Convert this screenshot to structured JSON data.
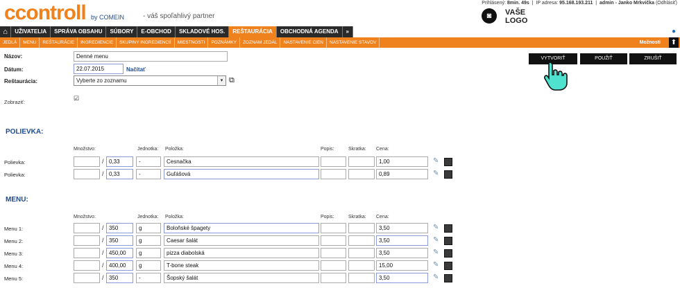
{
  "header": {
    "logo": "ccontroll",
    "by": "by COMEIN",
    "tagline": "- váš spoľahlivý partner",
    "session": {
      "logged_label": "Prihlásený:",
      "logged_time": "8min. 49s",
      "ip_label": "IP adresa:",
      "ip": "95.168.193.211",
      "user": "admin - Janko Mrkvička",
      "logout": "(Odhlásiť)"
    },
    "your_logo_line1": "VAŠE",
    "your_logo_line2": "LOGO"
  },
  "main_nav": [
    {
      "label": "UŽIVATELIA"
    },
    {
      "label": "SPRÁVA OBSAHU"
    },
    {
      "label": "SÚBORY"
    },
    {
      "label": "E-OBCHOD"
    },
    {
      "label": "SKLADOVÉ HOS."
    },
    {
      "label": "REŠTAURÁCIA",
      "active": true
    },
    {
      "label": "OBCHODNÁ AGENDA"
    },
    {
      "label": "»"
    }
  ],
  "sub_nav": [
    "JEDLÁ",
    "MENU",
    "REŠTAURÁCIE",
    "INGREDIENCIE",
    "SKUPINY INGREDIENCIÍ",
    "MIESTNOSTI",
    "POZNÁMKY",
    "ZOZNAM JEDÁL",
    "NASTAVENIE CIEN",
    "NASTAVENIE STAVOV"
  ],
  "options_label": "Možnosti",
  "form": {
    "name_label": "Názov:",
    "name_value": "Denné menu",
    "date_label": "Dátum:",
    "date_value": "22.07.2015",
    "load_link": "Načítať",
    "restaurant_label": "Reštaurácia:",
    "restaurant_value": "Vyberte zo zoznamu",
    "show_label": "Zobraziť:",
    "show_checked": true
  },
  "buttons": {
    "create": "VYTVORIŤ",
    "use": "POUŽIŤ",
    "cancel": "ZRUŠIŤ"
  },
  "columns": {
    "qty": "Množstvo:",
    "unit": "Jednotka:",
    "item": "Položka:",
    "desc": "Popis:",
    "abbr": "Skratka:",
    "price": "Cena:"
  },
  "soups": {
    "title": "POLIEVKA:",
    "rows": [
      {
        "label": "Polievka:",
        "qty": "",
        "amount": "0,33",
        "unit": "-",
        "item": "Cesnačka",
        "desc": "",
        "abbr": "",
        "price": "1,00"
      },
      {
        "label": "Polievka:",
        "qty": "",
        "amount": "0,33",
        "unit": "-",
        "item": "Guľášová",
        "desc": "",
        "abbr": "",
        "price": "0,89"
      }
    ]
  },
  "menu": {
    "title": "MENU:",
    "rows": [
      {
        "label": "Menu 1:",
        "qty": "",
        "amount": "350",
        "unit": "g",
        "item": "Boloňské špagety",
        "desc": "",
        "abbr": "",
        "price": "3,50"
      },
      {
        "label": "Menu 2:",
        "qty": "",
        "amount": "350",
        "unit": "g",
        "item": "Caesar šalát",
        "desc": "",
        "abbr": "",
        "price": "3,50"
      },
      {
        "label": "Menu 3:",
        "qty": "",
        "amount": "450,00",
        "unit": "g",
        "item": "pizza diabolská",
        "desc": "",
        "abbr": "",
        "price": "3,50"
      },
      {
        "label": "Menu 4:",
        "qty": "",
        "amount": "400,00",
        "unit": "g",
        "item": "T-bone steak",
        "desc": "",
        "abbr": "",
        "price": "15,00"
      },
      {
        "label": "Menu 5:",
        "qty": "",
        "amount": "350",
        "unit": "-",
        "item": "Šopský šalát",
        "desc": "",
        "abbr": "",
        "price": "3,50"
      }
    ]
  },
  "colors": {
    "accent": "#f0821e",
    "nav_dark": "#2a2a2a",
    "section_blue": "#1d4b8f"
  }
}
